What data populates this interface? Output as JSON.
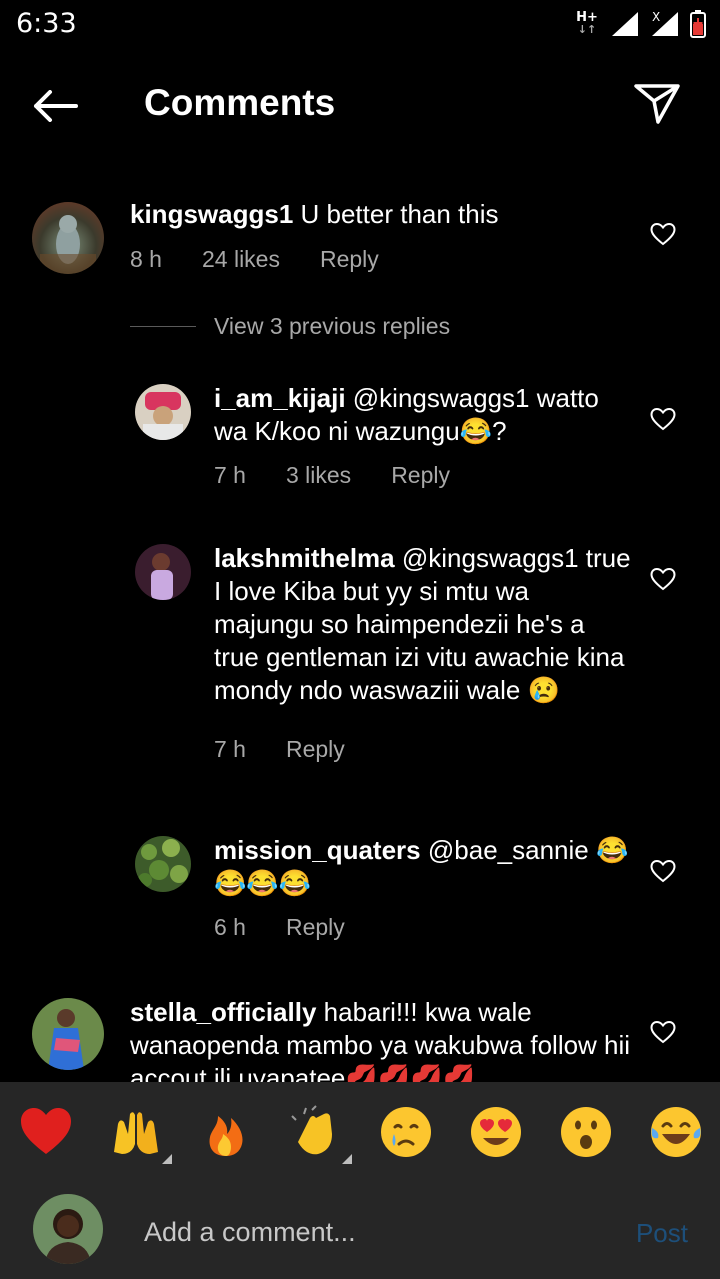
{
  "status_bar": {
    "time": "6:33",
    "network_type": "H+",
    "network_arrows": "↓↑",
    "roaming_mark": "X"
  },
  "header": {
    "title": "Comments"
  },
  "comments": [
    {
      "username": "kingswaggs1",
      "text": "U better than this",
      "time": "8 h",
      "likes": "24 likes",
      "reply": "Reply",
      "view_replies": "View 3 previous replies"
    },
    {
      "username": "i_am_kijaji",
      "text": "@kingswaggs1 watto wa K/koo ni wazungu😂?",
      "time": "7 h",
      "likes": "3 likes",
      "reply": "Reply"
    },
    {
      "username": "lakshmithelma",
      "text": "@kingswaggs1 true I love Kiba but yy si mtu wa majungu so haimpendezii he's a true gentleman izi vitu awachie kina mondy ndo waswaziii wale 😢",
      "time": "7 h",
      "reply": "Reply"
    },
    {
      "username": "mission_quaters",
      "text": "@bae_sannie 😂😂😂😂",
      "time": "6 h",
      "reply": "Reply"
    },
    {
      "username": "stella_officially",
      "text": "habari!!! kwa wale wanaopenda mambo ya wakubwa follow hii accout ili uyapatee💋💋💋💋"
    }
  ],
  "emoji_bar": [
    "heart",
    "raised-hands",
    "fire",
    "clapping-hands",
    "crying-face",
    "heart-eyes",
    "surprised-face",
    "tears-of-joy"
  ],
  "input": {
    "placeholder": "Add a comment...",
    "post_label": "Post"
  },
  "colors": {
    "background": "#000000",
    "secondary_text": "#a8a8a8",
    "panel": "#262626",
    "post_disabled": "#1d4f7a"
  }
}
